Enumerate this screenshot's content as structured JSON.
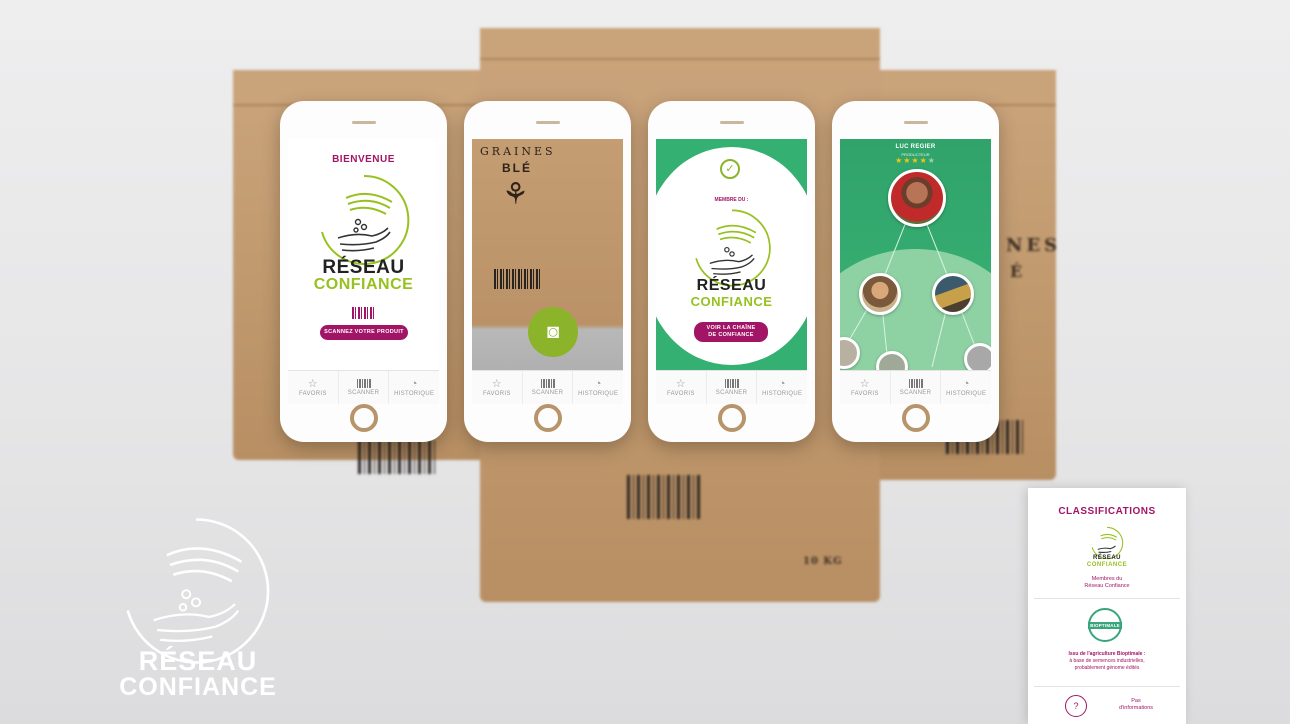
{
  "background": {
    "bag_center": {
      "title1": "GRAINES",
      "title2": "BLÉ",
      "weight": "10 KG"
    },
    "bag_right": {
      "partial1": "NES",
      "partial2": "É"
    }
  },
  "brand": {
    "word1": "RÉSEAU",
    "word2": "CONFIANCE",
    "accent": "#96c11f",
    "magenta": "#a21566"
  },
  "tabbar": {
    "favori": "FAVORIS",
    "scanner": "SCANNER",
    "historique": "HISTORIQUE"
  },
  "phone1": {
    "heading": "BIENVENUE",
    "button": "SCANNEZ VOTRE PRODUIT"
  },
  "phone2": {
    "title1": "GRAINES",
    "title2": "BLÉ"
  },
  "phone3": {
    "member_label": "MEMBRE DU :",
    "button_line1": "VOIR LA CHAÎNE",
    "button_line2": "DE CONFIANCE"
  },
  "phone4": {
    "name": "LUC REGIER",
    "role": "PRODUCTEUR",
    "rating": 4
  },
  "panel": {
    "title": "CLASSIFICATIONS",
    "item1": {
      "caption_line1": "Membres du",
      "caption_line2": "Réseau Confiance"
    },
    "item2": {
      "seal": "BIOPTIMALE",
      "caption_line1": "Issu de l'agriculture Bioptimale :",
      "caption_line2": "à base de semences industrielles,",
      "caption_line3": "probablement génome édités"
    },
    "item3": {
      "icon": "?",
      "caption_line1": "Pas",
      "caption_line2": "d'informations"
    }
  }
}
